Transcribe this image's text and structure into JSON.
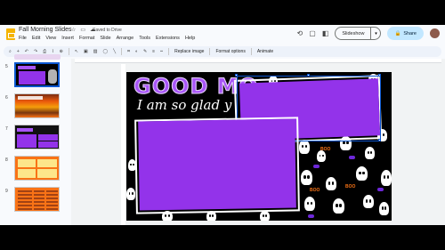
{
  "app": {
    "title": "Fall Morning Slides",
    "saved_status": "Saved to Drive",
    "menu": [
      "File",
      "Edit",
      "View",
      "Insert",
      "Format",
      "Slide",
      "Arrange",
      "Tools",
      "Extensions",
      "Help"
    ],
    "slideshow_label": "Slideshow",
    "share_label": "Share"
  },
  "toolbar": {
    "replace_image": "Replace image",
    "format_options": "Format options",
    "animate": "Animate"
  },
  "filmstrip": {
    "slides": [
      {
        "number": "5",
        "selected": true
      },
      {
        "number": "6",
        "selected": false
      },
      {
        "number": "7",
        "selected": false
      },
      {
        "number": "8",
        "selected": false
      },
      {
        "number": "9",
        "selected": false
      }
    ]
  },
  "slide": {
    "heading": "GOOD MO",
    "subheading": "I am so glad y"
  },
  "colors": {
    "accent_purple": "#9333ea",
    "share_bg": "#c2e7ff",
    "selection_blue": "#0b57d0"
  },
  "icons": [
    "star-icon",
    "move-to-folder-icon",
    "cloud-saved-icon",
    "history-icon",
    "comment-icon",
    "meet-icon",
    "share-lock-icon"
  ]
}
